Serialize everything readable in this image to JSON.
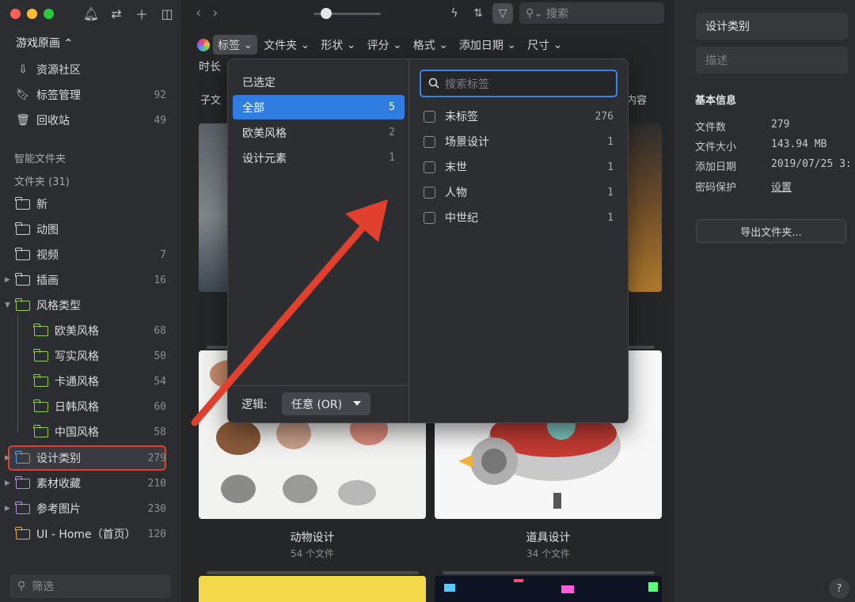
{
  "sidebar": {
    "library": "游戏原画 ⌃",
    "top_items": [
      {
        "label": "资源社区",
        "count": ""
      },
      {
        "label": "标签管理",
        "count": "92"
      },
      {
        "label": "回收站",
        "count": "49"
      }
    ],
    "smart_folders": "智能文件夹",
    "folders_header": "文件夹 (31)",
    "folders": [
      {
        "label": "新",
        "count": ""
      },
      {
        "label": "动图",
        "count": ""
      },
      {
        "label": "视频",
        "count": "7"
      },
      {
        "label": "插画",
        "count": "16"
      },
      {
        "label": "风格类型",
        "count": ""
      },
      {
        "label": "欧美风格",
        "count": "68"
      },
      {
        "label": "写实风格",
        "count": "50"
      },
      {
        "label": "卡通风格",
        "count": "54"
      },
      {
        "label": "日韩风格",
        "count": "60"
      },
      {
        "label": "中国风格",
        "count": "58"
      },
      {
        "label": "设计类别",
        "count": "279"
      },
      {
        "label": "素材收藏",
        "count": "210"
      },
      {
        "label": "参考图片",
        "count": "230"
      },
      {
        "label": "UI - Home（首页）",
        "count": "120"
      }
    ],
    "filter_placeholder": "筛选"
  },
  "toolbar": {
    "search_placeholder": "搜索",
    "filters": [
      "标签",
      "文件夹",
      "形状",
      "评分",
      "格式",
      "添加日期",
      "尺寸"
    ],
    "duration": "时长",
    "subfolder": "子文",
    "content": "内容"
  },
  "cards": [
    {
      "title": "动物设计",
      "sub": "54 个文件"
    },
    {
      "title": "道具设计",
      "sub": "34 个文件"
    }
  ],
  "popover": {
    "left": [
      {
        "label": "已选定",
        "count": ""
      },
      {
        "label": "全部",
        "count": "5"
      },
      {
        "label": "欧美风格",
        "count": "2"
      },
      {
        "label": "设计元素",
        "count": "1"
      }
    ],
    "logic_label": "逻辑:",
    "logic_value": "任意 (OR)",
    "search_placeholder": "搜索标签",
    "tags": [
      {
        "label": "未标签",
        "count": "276"
      },
      {
        "label": "场景设计",
        "count": "1"
      },
      {
        "label": "末世",
        "count": "1"
      },
      {
        "label": "人物",
        "count": "1"
      },
      {
        "label": "中世纪",
        "count": "1"
      }
    ]
  },
  "right": {
    "name": "设计类别",
    "desc_placeholder": "描述",
    "info_header": "基本信息",
    "info": [
      {
        "k": "文件数",
        "v": "279"
      },
      {
        "k": "文件大小",
        "v": "143.94 MB"
      },
      {
        "k": "添加日期",
        "v": "2019/07/25 3:"
      },
      {
        "k": "密码保护",
        "v": "设置"
      }
    ],
    "export": "导出文件夹...",
    "help": "?"
  },
  "colors": {
    "accent": "#2f7de1",
    "highlight": "#e0402d"
  }
}
